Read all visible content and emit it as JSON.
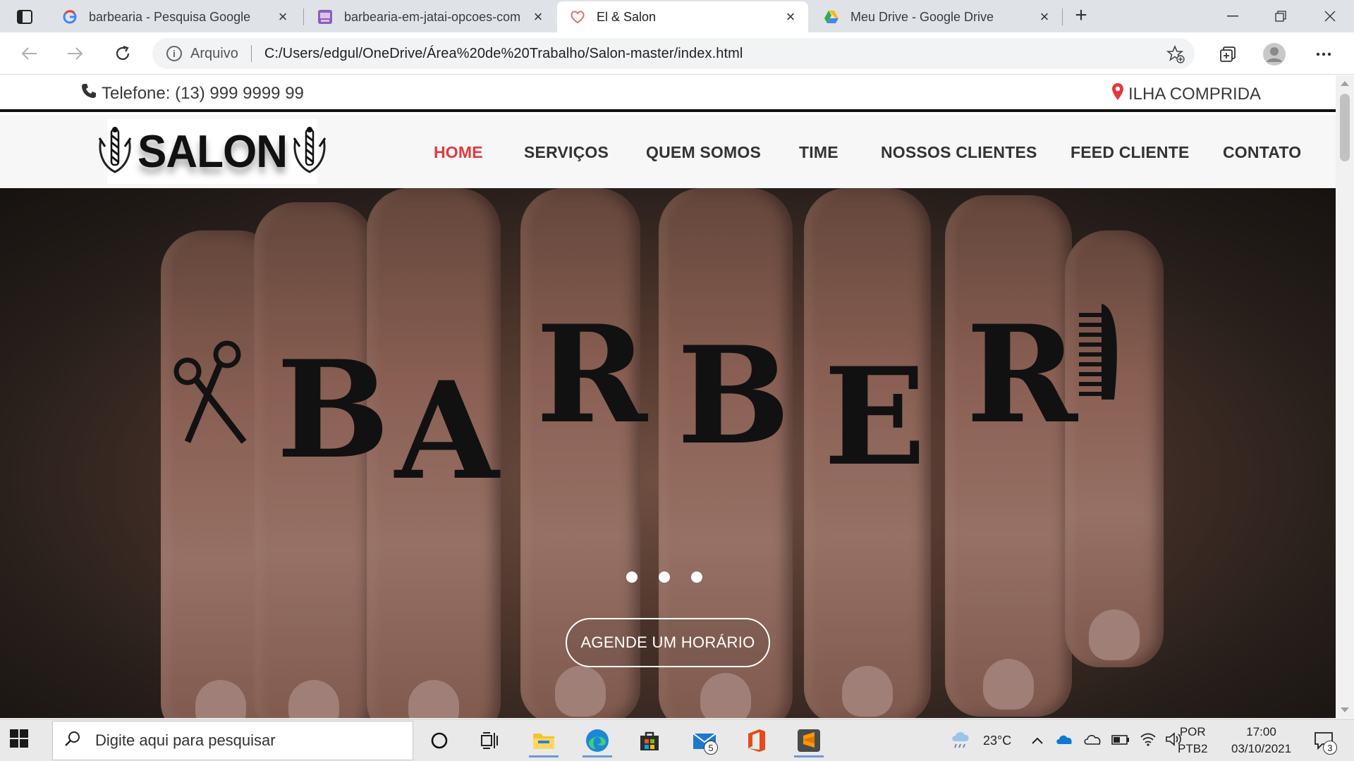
{
  "browser": {
    "tabs": [
      {
        "title": "barbearia - Pesquisa Google",
        "favicon": "google-icon",
        "active": false
      },
      {
        "title": "barbearia-em-jatai-opcoes-com",
        "favicon": "site-favicon-icon",
        "active": false
      },
      {
        "title": "El & Salon",
        "favicon": "salon-heart-icon",
        "active": true
      },
      {
        "title": "Meu Drive - Google Drive",
        "favicon": "google-drive-icon",
        "active": false
      }
    ],
    "address": {
      "scheme_label": "Arquivo",
      "url": "C:/Users/edgul/OneDrive/Área%20de%20Trabalho/Salon-master/index.html"
    }
  },
  "site": {
    "topbar": {
      "phone": "Telefone: (13) 999 9999 99",
      "location": "ILHA COMPRIDA"
    },
    "logo_text": "SALON",
    "nav": [
      {
        "label": "HOME",
        "active": true
      },
      {
        "label": "SERVIÇOS",
        "active": false
      },
      {
        "label": "QUEM SOMOS",
        "active": false
      },
      {
        "label": "TIME",
        "active": false
      },
      {
        "label": "NOSSOS CLIENTES",
        "active": false
      },
      {
        "label": "FEED CLIENTE",
        "active": false
      },
      {
        "label": "CONTATO",
        "active": false
      }
    ],
    "hero": {
      "tattoo_letters": [
        "B",
        "A",
        "R",
        "B",
        "E",
        "R"
      ],
      "slides": 3,
      "cta": "AGENDE UM HORÁRIO"
    },
    "colors": {
      "accent": "#e03a3e",
      "nav_text": "#333333"
    }
  },
  "taskbar": {
    "search_placeholder": "Digite aqui para pesquisar",
    "mail_badge": "5",
    "weather": "23°C",
    "lang_top": "POR",
    "lang_bottom": "PTB2",
    "time": "17:00",
    "date": "03/10/2021",
    "notifications": "3"
  }
}
